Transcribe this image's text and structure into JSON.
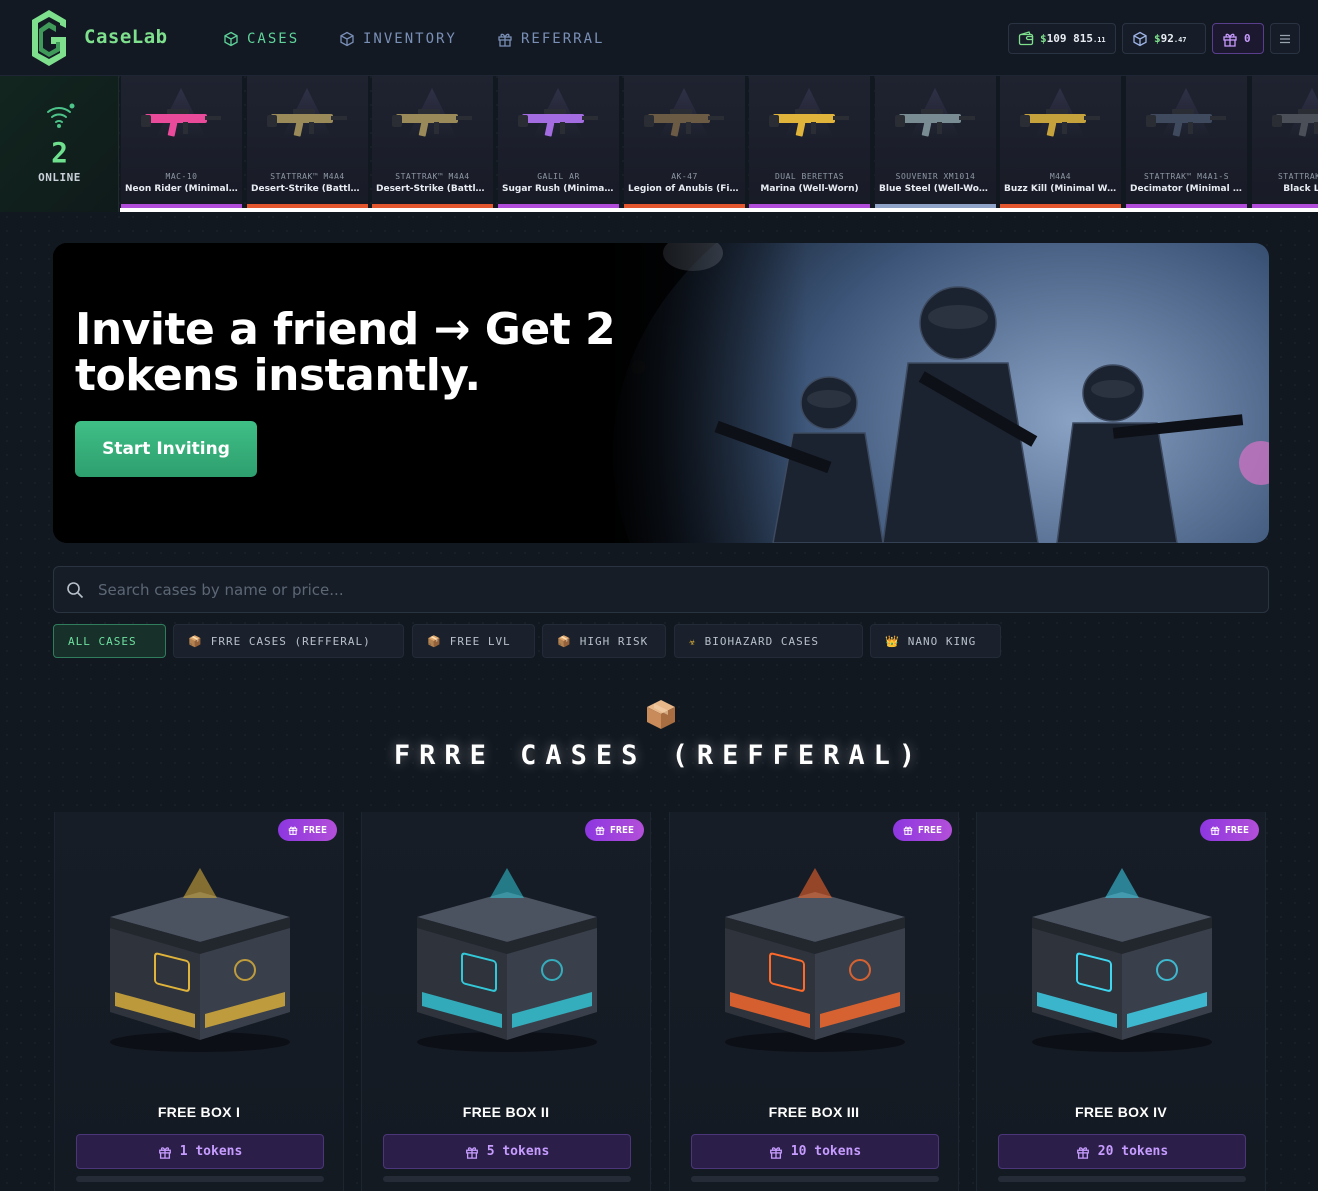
{
  "header": {
    "logo_text": "CaseLab",
    "nav": [
      {
        "label": "CASES",
        "icon": "cube-icon",
        "active": true
      },
      {
        "label": "INVENTORY",
        "icon": "cube-icon",
        "active": false
      },
      {
        "label": "REFERRAL",
        "icon": "gift-icon",
        "active": false
      }
    ],
    "balance": {
      "currency": "$",
      "amount": "109 815",
      "cents": ".11"
    },
    "points": {
      "currency": "$",
      "amount": "92",
      "cents": ".47"
    },
    "gifts_count": "0"
  },
  "live": {
    "online_count": "2",
    "online_label": "ONLINE",
    "drops": [
      {
        "type": "MAC-10",
        "name": "Neon Rider (Minimal Wear)",
        "rarity_color": "#b14bd9",
        "gun_color": "#e94a9a"
      },
      {
        "type": "StatTrak™ M4A4",
        "name": "Desert-Strike (Battle-Scarred)",
        "rarity_color": "#e4572e",
        "gun_color": "#9a8a5a"
      },
      {
        "type": "StatTrak™ M4A4",
        "name": "Desert-Strike (Battle-Scarred)",
        "rarity_color": "#e4572e",
        "gun_color": "#9a8a5a"
      },
      {
        "type": "Galil AR",
        "name": "Sugar Rush (Minimal Wear)",
        "rarity_color": "#b14bd9",
        "gun_color": "#a36ce0"
      },
      {
        "type": "AK-47",
        "name": "Legion of Anubis (Field-Tested)",
        "rarity_color": "#e4572e",
        "gun_color": "#6b5a44"
      },
      {
        "type": "Dual Berettas",
        "name": "Marina (Well-Worn)",
        "rarity_color": "#b14bd9",
        "gun_color": "#e0b33a"
      },
      {
        "type": "Souvenir XM1014",
        "name": "Blue Steel (Well-Worn)",
        "rarity_color": "#8fa3c8",
        "gun_color": "#7a8c93"
      },
      {
        "type": "M4A4",
        "name": "Buzz Kill (Minimal Wear)",
        "rarity_color": "#e4572e",
        "gun_color": "#c6a23c"
      },
      {
        "type": "StatTrak™ M4A1-S",
        "name": "Decimator (Minimal Wear)",
        "rarity_color": "#b14bd9",
        "gun_color": "#3f4a5e"
      },
      {
        "type": "StatTrak™ ...",
        "name": "Black Lotus",
        "rarity_color": "#b14bd9",
        "gun_color": "#4a4f58"
      }
    ]
  },
  "banner": {
    "title": "Invite a friend → Get 2 tokens instantly.",
    "button_label": "Start Inviting"
  },
  "search": {
    "placeholder": "Search cases by name or price..."
  },
  "filters": [
    {
      "label": "ALL CASES",
      "icon": "",
      "active": true
    },
    {
      "label": "FRRE CASES (REFFERAL)",
      "icon": "📦",
      "active": false
    },
    {
      "label": "FREE LVL",
      "icon": "📦",
      "active": false
    },
    {
      "label": "HIGH RISK",
      "icon": "📦",
      "active": false
    },
    {
      "label": "BIOHAZARD CASES",
      "icon": "☣",
      "active": false
    },
    {
      "label": "NANO KING",
      "icon": "👑",
      "active": false
    }
  ],
  "section": {
    "icon": "box-icon",
    "title": "FRRE CASES (REFFERAL)"
  },
  "cases": [
    {
      "name": "FREE BOX I",
      "badge": "FREE",
      "price": "1 tokens",
      "accent": "#e0b33a"
    },
    {
      "name": "FREE BOX II",
      "badge": "FREE",
      "price": "5 tokens",
      "accent": "#33c8d8"
    },
    {
      "name": "FREE BOX III",
      "badge": "FREE",
      "price": "10 tokens",
      "accent": "#ff6a2a"
    },
    {
      "name": "FREE BOX IV",
      "badge": "FREE",
      "price": "20 tokens",
      "accent": "#3fd6f0"
    }
  ]
}
